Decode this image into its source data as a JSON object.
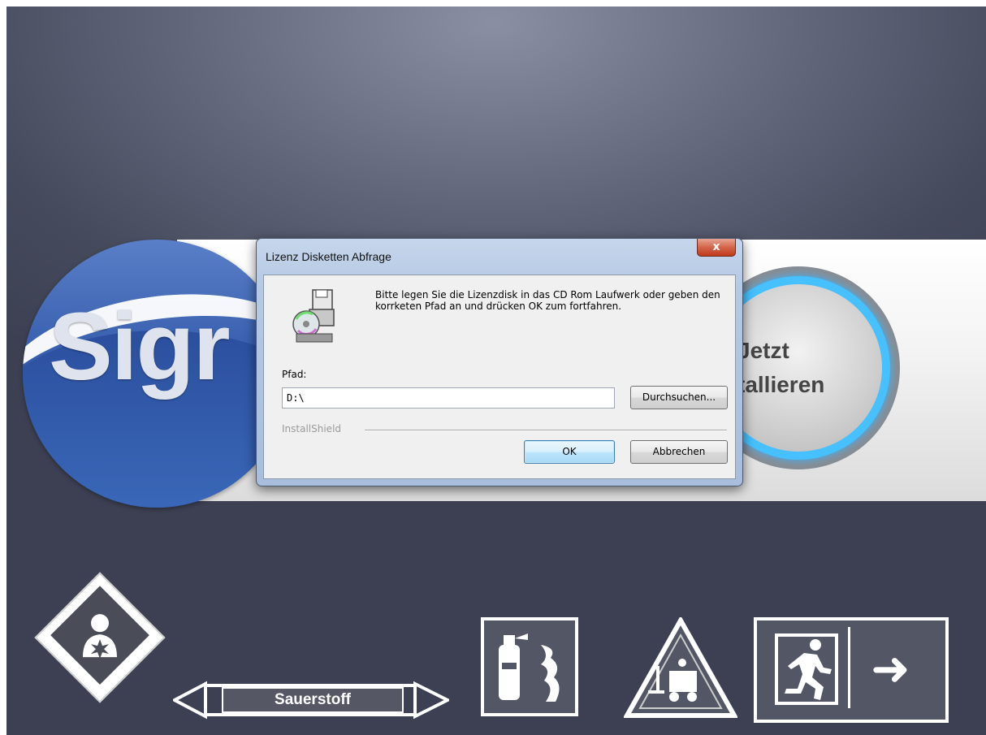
{
  "background": {
    "logo_text": "Sigr",
    "install_button": {
      "line1": "Jetzt",
      "line2": "tallieren"
    },
    "colors": {
      "accent_blue": "#3bb6ff",
      "logo_blue": "#2d55a6"
    }
  },
  "dialog": {
    "title": "Lizenz Disketten Abfrage",
    "close_label": "x",
    "icon": "disk-drive-icon",
    "message": "Bitte legen Sie die Lizenzdisk in das CD Rom Laufwerk oder geben den korrketen Pfad an und drücken OK zum fortfahren.",
    "path_label": "Pfad:",
    "path_value": "D:\\",
    "browse_label": "Durchsuchen...",
    "group_label": "InstallShield",
    "ok_label": "OK",
    "cancel_label": "Abbrechen"
  },
  "signs": {
    "pipe_label": "Sauerstoff",
    "icons": [
      "health-hazard-sign-icon",
      "fire-extinguisher-sign-icon",
      "forklift-warning-sign-icon",
      "emergency-exit-sign-icon"
    ]
  }
}
